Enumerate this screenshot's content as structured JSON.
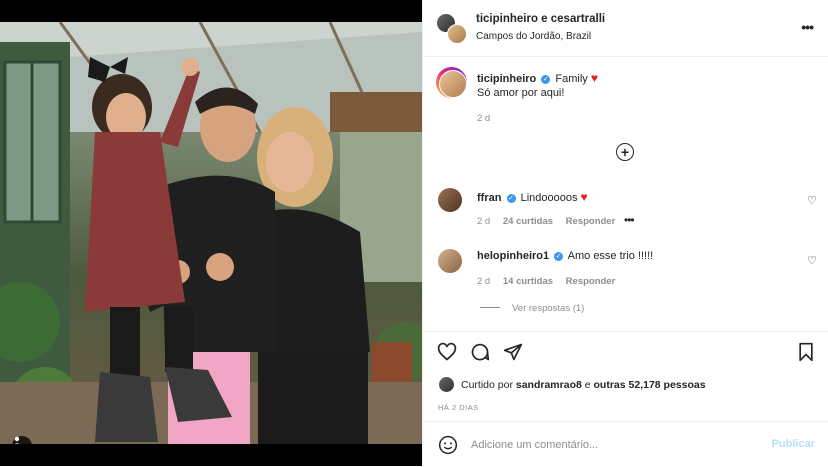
{
  "header": {
    "title": "ticipinheiro e cesartralli",
    "location": "Campos do Jordão, Brazil"
  },
  "caption": {
    "username": "ticipinheiro",
    "text1": "Family",
    "text2": "Só amor por aqui!",
    "time": "2 d"
  },
  "comments": [
    {
      "username": "ffran",
      "text": "Lindooooos",
      "time": "2 d",
      "likes": "24 curtidas",
      "reply": "Responder",
      "more": "•••"
    },
    {
      "username": "helopinheiro1",
      "text": "Amo esse trio !!!!!",
      "time": "2 d",
      "likes": "14 curtidas",
      "reply": "Responder"
    }
  ],
  "view_replies": "Ver respostas (1)",
  "likes": {
    "prefix": "Curtido por",
    "user": "sandramrao8",
    "middle": "e",
    "others": "outras 52,178 pessoas"
  },
  "post_date": "HÁ 2 DIAS",
  "comment_box": {
    "placeholder": "Adicione um comentário...",
    "post_label": "Publicar"
  },
  "colors": {
    "verified": "#3897f0",
    "heart": "#ed1c24",
    "post_disabled": "#b2dffc"
  }
}
